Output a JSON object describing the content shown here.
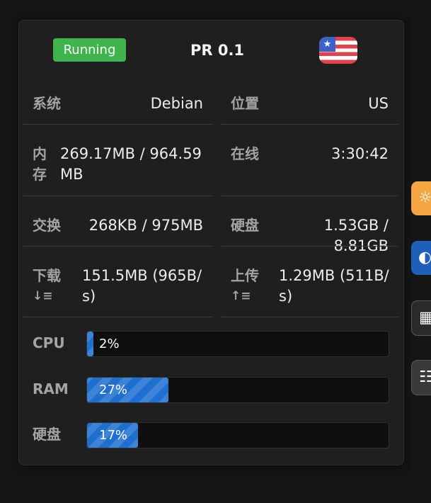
{
  "status": "Running",
  "title": "PR 0.1",
  "flag_icon": "us-flag-icon",
  "flag_star": "★",
  "info": {
    "os_label": "系统",
    "os_value": "Debian",
    "loc_label": "位置",
    "loc_value": "US",
    "mem_label_1": "内",
    "mem_label_2": "存",
    "mem_value_1": "269.17MB / 964.59",
    "mem_value_2": "MB",
    "online_label": "在线",
    "online_value": "3:30:42",
    "swap_label": "交换",
    "swap_value": "268KB / 975MB",
    "disk_label": "硬盘",
    "disk_value": "1.53GB / 8.81GB",
    "down_label": "下载",
    "down_icon": "↓≡",
    "down_value_1": "151.5MB (965B/",
    "down_value_2": "s)",
    "up_label": "上传",
    "up_icon": "↑≡",
    "up_value_1": "1.29MB (511B/",
    "up_value_2": "s)"
  },
  "bars": [
    {
      "label": "CPU",
      "percent": 2,
      "text": "2%"
    },
    {
      "label": "RAM",
      "percent": 27,
      "text": "27%"
    },
    {
      "label": "硬盘",
      "percent": 17,
      "text": "17%"
    }
  ],
  "side_buttons": [
    {
      "icon": "sun-icon",
      "glyph": "☼",
      "color": "#f4a640"
    },
    {
      "icon": "theme-icon",
      "glyph": "◐",
      "color": "#1f5fb8"
    },
    {
      "icon": "grid-icon",
      "glyph": "▦",
      "color": "#2a2a2a"
    },
    {
      "icon": "list-icon",
      "glyph": "☷",
      "color": "#3a3a3a"
    }
  ]
}
